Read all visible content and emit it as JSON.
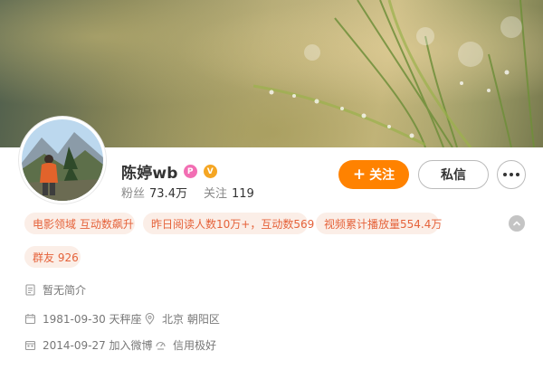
{
  "profile": {
    "name": "陈婷wb",
    "badge_p": "P",
    "badge_v": "V",
    "followers_label": "粉丝",
    "followers_value": "73.4万",
    "following_label": "关注",
    "following_value": "119"
  },
  "actions": {
    "follow_plus": "+",
    "follow_label": "关注",
    "message_label": "私信"
  },
  "tags": [
    "电影领域 互动数飙升",
    "昨日阅读人数10万+，互动数569",
    "视频累计播放量554.4万",
    "群友 926"
  ],
  "info": {
    "bio": "暂无简介",
    "birthday": "1981-09-30 天秤座",
    "location": "北京 朝阳区",
    "joined": "2014-09-27 加入微博",
    "credit": "信用极好"
  },
  "colors": {
    "accent": "#ff8200",
    "tag_bg": "#fbeee7",
    "tag_text": "#e5623a",
    "badge_p": "#f26eb3",
    "badge_v": "#f5a623"
  },
  "icons": {
    "bio": "document-icon",
    "birthday": "calendar-icon",
    "location": "location-pin-icon",
    "joined": "calendar-icon",
    "credit": "credit-icon",
    "collapse": "chevron-up-icon",
    "more": "more-dots-icon"
  }
}
